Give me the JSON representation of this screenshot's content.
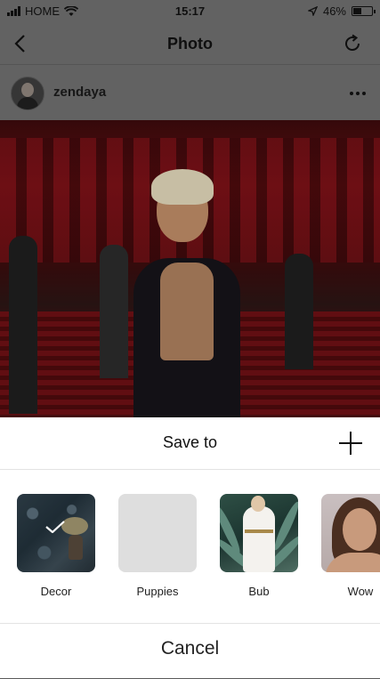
{
  "status_bar": {
    "carrier": "HOME",
    "time": "15:17",
    "battery": "46%",
    "battery_level": 0.46
  },
  "nav": {
    "title": "Photo",
    "back_icon": "chevron-left-icon",
    "refresh_icon": "refresh-icon"
  },
  "post": {
    "username": "zendaya",
    "more_icon": "more-horizontal-icon"
  },
  "sheet": {
    "title": "Save to",
    "add_icon": "plus-icon",
    "collections": [
      {
        "label": "Decor",
        "selected": true
      },
      {
        "label": "Puppies",
        "selected": false
      },
      {
        "label": "Bub",
        "selected": false
      },
      {
        "label": "Wow",
        "selected": false
      }
    ],
    "cancel_label": "Cancel"
  }
}
